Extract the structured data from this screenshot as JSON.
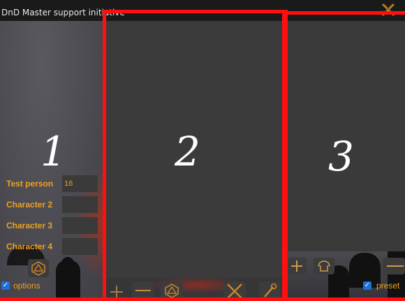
{
  "window": {
    "title": "DnD Master support initiative"
  },
  "panels": [
    {
      "number": "1"
    },
    {
      "number": "2"
    },
    {
      "number": "3"
    }
  ],
  "characters": [
    {
      "name": "Test person",
      "initiative": "16"
    },
    {
      "name": "Character 2",
      "initiative": ""
    },
    {
      "name": "Character 3",
      "initiative": ""
    },
    {
      "name": "Character 4",
      "initiative": ""
    }
  ],
  "options": {
    "label": "options",
    "checked": true
  },
  "preset": {
    "label": "preset",
    "checked": true
  },
  "colors": {
    "accent": "#f0a01a",
    "outline": "#ff1010",
    "checkbox": "#1e6fd6"
  },
  "icons": [
    "d20-icon",
    "plus-icon",
    "minus-icon",
    "close-icon",
    "wrench-icon",
    "shirt-icon"
  ]
}
